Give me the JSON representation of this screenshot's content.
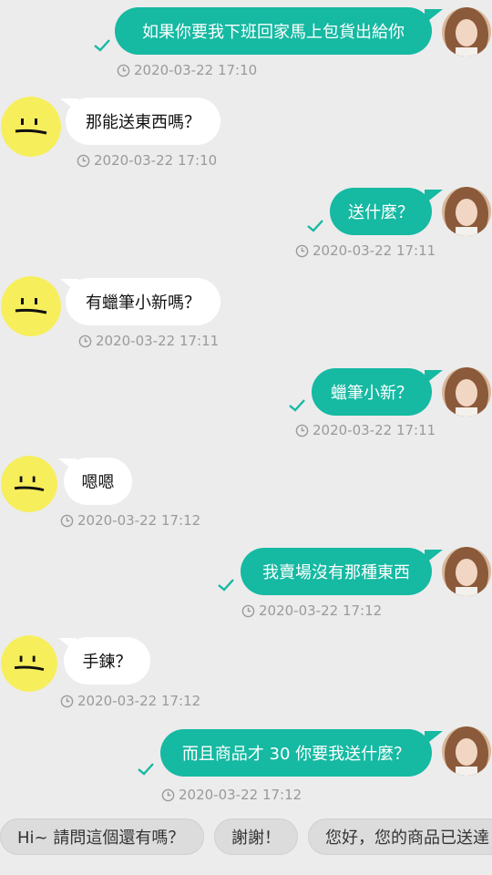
{
  "messages": [
    {
      "side": "out",
      "text": "如果你要我下班回家馬上包貨出給你",
      "time": "2020-03-22 17:10"
    },
    {
      "side": "in",
      "text": "那能送東西嗎？",
      "time": "2020-03-22 17:10"
    },
    {
      "side": "out",
      "text": "送什麼？",
      "time": "2020-03-22 17:11"
    },
    {
      "side": "in",
      "text": "有蠟筆小新嗎？",
      "time": "2020-03-22 17:11"
    },
    {
      "side": "out",
      "text": "蠟筆小新？",
      "time": "2020-03-22 17:11"
    },
    {
      "side": "in",
      "text": "嗯嗯",
      "time": "2020-03-22 17:12"
    },
    {
      "side": "out",
      "text": "我賣場沒有那種東西",
      "time": "2020-03-22 17:12"
    },
    {
      "side": "in",
      "text": "手鍊？",
      "time": "2020-03-22 17:12"
    },
    {
      "side": "out",
      "text": "而且商品才 30 你要我送什麼？",
      "time": "2020-03-22 17:12"
    }
  ],
  "quick_replies": [
    "Hi~ 請問這個還有嗎？",
    "謝謝！",
    "您好，您的商品已送達"
  ],
  "colors": {
    "outgoing_bubble": "#16b9a2",
    "incoming_bubble": "#ffffff",
    "background": "#ececec",
    "timestamp": "#9a9a9a"
  },
  "icons": {
    "read": "check-icon",
    "time": "clock-icon",
    "buyer_avatar": "smiley-face-icon",
    "seller_avatar": "profile-photo"
  }
}
